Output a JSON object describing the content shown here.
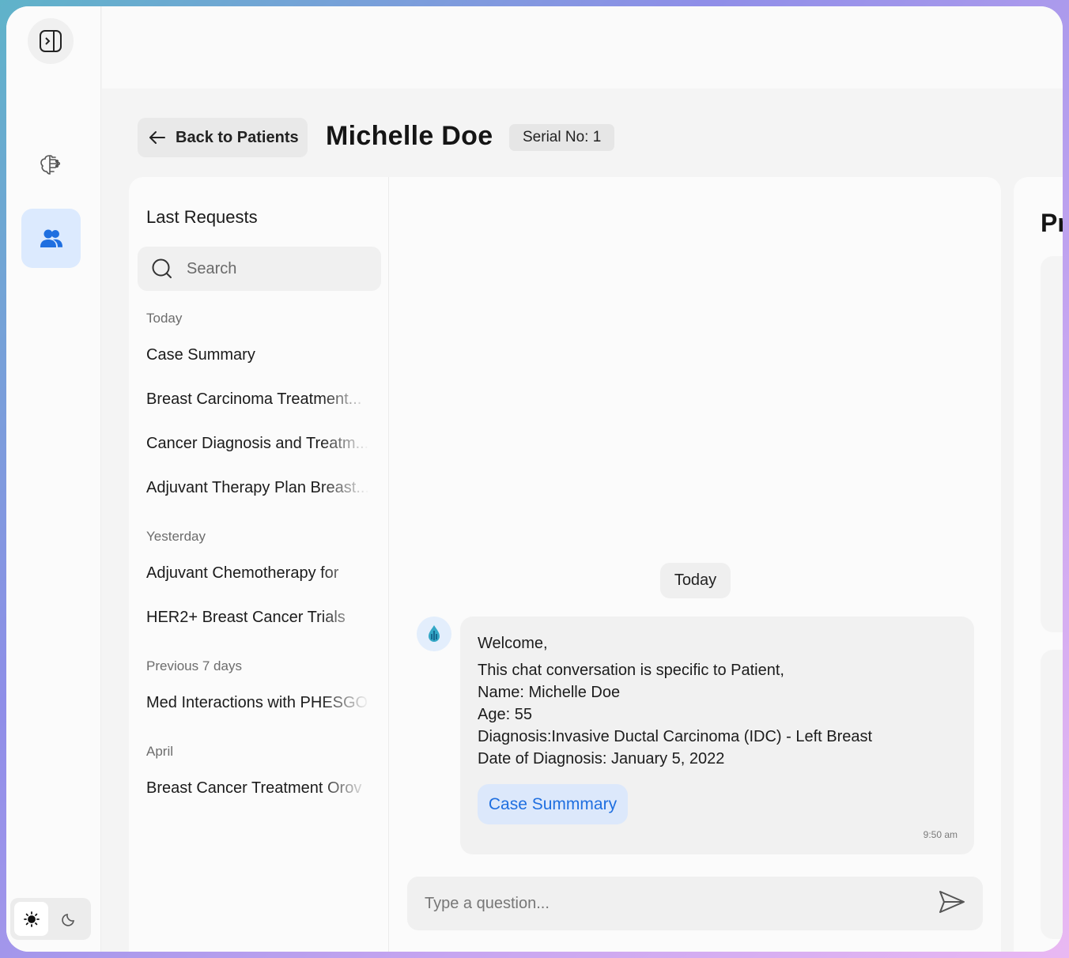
{
  "header": {
    "back_label": "Back to Patients",
    "patient_name": "Michelle Doe",
    "serial": "Serial No: 1"
  },
  "requests": {
    "title": "Last Requests",
    "search_placeholder": "Search",
    "groups": [
      {
        "label": "Today",
        "items": [
          "Case Summary",
          "Breast Carcinoma Treatment...",
          "Cancer Diagnosis and Treatm...",
          "Adjuvant Therapy Plan Breast..."
        ]
      },
      {
        "label": "Yesterday",
        "items": [
          "Adjuvant Chemotherapy for",
          "HER2+ Breast Cancer Trials"
        ]
      },
      {
        "label": "Previous 7 days",
        "items": [
          "Med Interactions with PHESGO"
        ]
      },
      {
        "label": "April",
        "items": [
          "Breast Cancer Treatment Orov"
        ]
      }
    ]
  },
  "chat": {
    "date_divider": "Today",
    "message": {
      "greeting": "Welcome,",
      "lines": [
        "This chat conversation is specific to Patient,",
        "Name: Michelle Doe",
        "Age: 55",
        "Diagnosis:Invasive Ductal Carcinoma (IDC) - Left Breast",
        "Date of Diagnosis: January 5, 2022"
      ],
      "action_label": "Case Summmary",
      "time": "9:50 am"
    },
    "composer_placeholder": "Type a question..."
  },
  "right_panel": {
    "title_partial": "Pr"
  },
  "icons": {
    "sidebar_toggle": "sidebar-toggle-icon",
    "brain": "brain-icon",
    "patients": "users-icon",
    "light": "sun-icon",
    "dark": "moon-icon",
    "back": "arrow-left-icon",
    "search": "search-icon",
    "send": "send-icon"
  },
  "colors": {
    "accent": "#1f6fe0",
    "accent_bg": "#dce8fb"
  }
}
